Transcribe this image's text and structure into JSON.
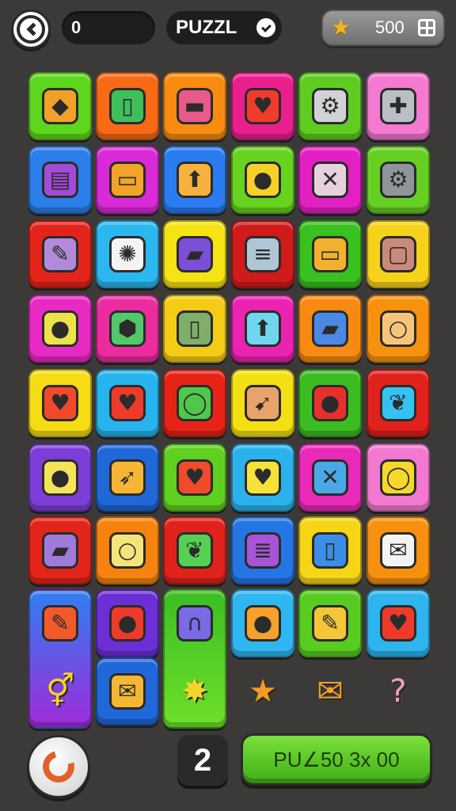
{
  "header": {
    "score_value": "0",
    "title": "PUZZL",
    "coins": "500"
  },
  "footer": {
    "moves": "2",
    "play_label": "PU∠50 3x 00"
  },
  "tiles": [
    {
      "row": 0,
      "col": 0,
      "color": "#5ed61e",
      "icon": "diamond-sign-icon",
      "glyph": "◆",
      "fill": "#f0a12a"
    },
    {
      "row": 0,
      "col": 1,
      "color": "#f86a16",
      "icon": "tablet-icon",
      "glyph": "▯",
      "fill": "#3fbf5a"
    },
    {
      "row": 0,
      "col": 2,
      "color": "#f98c10",
      "icon": "bandage-icon",
      "glyph": "▬",
      "fill": "#e85a8a"
    },
    {
      "row": 0,
      "col": 3,
      "color": "#ea1f8e",
      "icon": "heart-icon",
      "glyph": "♥",
      "fill": "#f13b2d"
    },
    {
      "row": 0,
      "col": 4,
      "color": "#5fcc22",
      "icon": "gear-lock-icon",
      "glyph": "⚙",
      "fill": "#cfd3d6"
    },
    {
      "row": 0,
      "col": 5,
      "color": "#f37ad0",
      "icon": "dpad-icon",
      "glyph": "✚",
      "fill": "#b9bfc4"
    },
    {
      "row": 1,
      "col": 0,
      "color": "#2c7ee8",
      "icon": "window-icon",
      "glyph": "▤",
      "fill": "#a24bd6"
    },
    {
      "row": 1,
      "col": 1,
      "color": "#d82ad6",
      "icon": "radio-icon",
      "glyph": "▭",
      "fill": "#f3a329"
    },
    {
      "row": 1,
      "col": 2,
      "color": "#2a7cf0",
      "icon": "mushroom-icon",
      "glyph": "⬆",
      "fill": "#f6b23c"
    },
    {
      "row": 1,
      "col": 3,
      "color": "#66d31f",
      "icon": "magnifier-icon",
      "glyph": "●",
      "fill": "#f6d028"
    },
    {
      "row": 1,
      "col": 4,
      "color": "#e321c3",
      "icon": "crosshair-icon",
      "glyph": "✕",
      "fill": "#e6d1dd"
    },
    {
      "row": 1,
      "col": 5,
      "color": "#66cf24",
      "icon": "gear-icon",
      "glyph": "⚙",
      "fill": "#8f969b"
    },
    {
      "row": 2,
      "col": 0,
      "color": "#e3241a",
      "icon": "pencil-icon",
      "glyph": "✎",
      "fill": "#b28ad9"
    },
    {
      "row": 2,
      "col": 1,
      "color": "#2bb7f0",
      "icon": "sun-gear-icon",
      "glyph": "✺",
      "fill": "#f4f4f4"
    },
    {
      "row": 2,
      "col": 2,
      "color": "#f5e313",
      "icon": "ruler-icon",
      "glyph": "▰",
      "fill": "#7b4fd6"
    },
    {
      "row": 2,
      "col": 3,
      "color": "#d11b1b",
      "icon": "document-icon",
      "glyph": "≡",
      "fill": "#b0c6d6"
    },
    {
      "row": 2,
      "col": 4,
      "color": "#39c120",
      "icon": "toolbox-icon",
      "glyph": "▭",
      "fill": "#f2b12c"
    },
    {
      "row": 2,
      "col": 5,
      "color": "#f6d21a",
      "icon": "briefcase-icon",
      "glyph": "▢",
      "fill": "#c98a7a"
    },
    {
      "row": 3,
      "col": 0,
      "color": "#e82ac4",
      "icon": "lemon-icon",
      "glyph": "●",
      "fill": "#ece34a"
    },
    {
      "row": 3,
      "col": 1,
      "color": "#ea2c9f",
      "icon": "hammer-icon",
      "glyph": "⬢",
      "fill": "#52c86a"
    },
    {
      "row": 3,
      "col": 2,
      "color": "#f4cc16",
      "icon": "tablet-icon",
      "glyph": "▯",
      "fill": "#7fae6a"
    },
    {
      "row": 3,
      "col": 3,
      "color": "#ea23b0",
      "icon": "arrow-up-icon",
      "glyph": "⬆",
      "fill": "#6fd6ee"
    },
    {
      "row": 3,
      "col": 4,
      "color": "#f78a12",
      "icon": "ruler-icon",
      "glyph": "▰",
      "fill": "#4a88e6"
    },
    {
      "row": 3,
      "col": 5,
      "color": "#f7920f",
      "icon": "magnifier-icon",
      "glyph": "○",
      "fill": "#f7c57a"
    },
    {
      "row": 4,
      "col": 0,
      "color": "#f6dc14",
      "icon": "heart-icon",
      "glyph": "♥",
      "fill": "#f04a2a"
    },
    {
      "row": 4,
      "col": 1,
      "color": "#27b3ee",
      "icon": "heart-icon",
      "glyph": "♥",
      "fill": "#ee3a2a"
    },
    {
      "row": 4,
      "col": 2,
      "color": "#e72318",
      "icon": "ring-icon",
      "glyph": "◯",
      "fill": "#4fc84a"
    },
    {
      "row": 4,
      "col": 3,
      "color": "#f4df13",
      "icon": "arrow-icon",
      "glyph": "➹",
      "fill": "#e8a36a"
    },
    {
      "row": 4,
      "col": 4,
      "color": "#3bbd22",
      "icon": "apple-icon",
      "glyph": "●",
      "fill": "#e8302a"
    },
    {
      "row": 4,
      "col": 5,
      "color": "#e1211b",
      "icon": "leaf-icon",
      "glyph": "❦",
      "fill": "#35c2f0"
    },
    {
      "row": 5,
      "col": 0,
      "color": "#7c3ed6",
      "icon": "bag-icon",
      "glyph": "●",
      "fill": "#f5e35a"
    },
    {
      "row": 5,
      "col": 1,
      "color": "#2067d8",
      "icon": "rocket-icon",
      "glyph": "➶",
      "fill": "#f5b733"
    },
    {
      "row": 5,
      "col": 2,
      "color": "#5fd01f",
      "icon": "heart-icon",
      "glyph": "♥",
      "fill": "#f04a2a"
    },
    {
      "row": 5,
      "col": 3,
      "color": "#2bb2ec",
      "icon": "heart-icon",
      "glyph": "♥",
      "fill": "#f7e23a"
    },
    {
      "row": 5,
      "col": 4,
      "color": "#ea2ab8",
      "icon": "cross-icon",
      "glyph": "✕",
      "fill": "#4aa8e6"
    },
    {
      "row": 5,
      "col": 5,
      "color": "#f278d0",
      "icon": "ring-icon",
      "glyph": "◯",
      "fill": "#f5d82a"
    },
    {
      "row": 6,
      "col": 0,
      "color": "#e3241a",
      "icon": "ruler-icon",
      "glyph": "▰",
      "fill": "#a07ad8"
    },
    {
      "row": 6,
      "col": 1,
      "color": "#f7830f",
      "icon": "magnifier-icon",
      "glyph": "○",
      "fill": "#f4e47a"
    },
    {
      "row": 6,
      "col": 2,
      "color": "#e0221a",
      "icon": "leaf-icon",
      "glyph": "❦",
      "fill": "#56cf55"
    },
    {
      "row": 6,
      "col": 3,
      "color": "#2576e4",
      "icon": "notes-icon",
      "glyph": "≣",
      "fill": "#a854d8"
    },
    {
      "row": 6,
      "col": 4,
      "color": "#f6d416",
      "icon": "phone-icon",
      "glyph": "▯",
      "fill": "#3b8ee6"
    },
    {
      "row": 6,
      "col": 5,
      "color": "#f7900f",
      "icon": "envelope-icon",
      "glyph": "✉",
      "fill": "#f3f3f3"
    },
    {
      "row": 7,
      "col": 0,
      "color": "#2c7ee8",
      "tall": true,
      "gradient": "linear-gradient(#2f7ff0,#9f2bd9)",
      "icon": "pencil-icon",
      "glyph": "✎",
      "fill": "#f25a2a"
    },
    {
      "row": 7,
      "col": 1,
      "color": "#6b2fd6",
      "icon": "bomb-icon",
      "glyph": "●",
      "fill": "#ee3a2a"
    },
    {
      "row": 7,
      "col": 2,
      "color": "#46c21f",
      "tall": true,
      "gradient": "linear-gradient(#3bbd22,#6fe02a)",
      "icon": "horseshoe-icon",
      "glyph": "∩",
      "fill": "#7a6ae6"
    },
    {
      "row": 7,
      "col": 3,
      "color": "#2fb6f0",
      "icon": "balloon-icon",
      "glyph": "●",
      "fill": "#f5a12a"
    },
    {
      "row": 7,
      "col": 4,
      "color": "#58cc20",
      "icon": "pen-icon",
      "glyph": "✎",
      "fill": "#f5c53a"
    },
    {
      "row": 7,
      "col": 5,
      "color": "#2eb4ee",
      "icon": "heart-icon",
      "glyph": "♥",
      "fill": "#ee3a2a"
    },
    {
      "row": 8,
      "col": 0,
      "color": "transparent",
      "skip": true,
      "icon": "gender-icon",
      "glyph": "⚥",
      "fill": "#f5d12a"
    },
    {
      "row": 8,
      "col": 1,
      "color": "#2067d8",
      "icon": "envelope-icon",
      "glyph": "✉",
      "fill": "#f5b733"
    },
    {
      "row": 8,
      "col": 2,
      "color": "transparent",
      "skip": true,
      "icon": "star-burst-icon",
      "glyph": "✸",
      "fill": "#f5d52a"
    },
    {
      "row": 8,
      "col": 3,
      "color": "transparent",
      "loose": true,
      "icon": "star-icon",
      "glyph": "★",
      "fill": "#f59a22"
    },
    {
      "row": 8,
      "col": 4,
      "color": "transparent",
      "loose": true,
      "icon": "envelope-icon",
      "glyph": "✉",
      "fill": "#f5a12a"
    },
    {
      "row": 8,
      "col": 5,
      "color": "transparent",
      "loose": true,
      "icon": "question-icon",
      "glyph": "?",
      "fill": "#f49bc8"
    }
  ]
}
